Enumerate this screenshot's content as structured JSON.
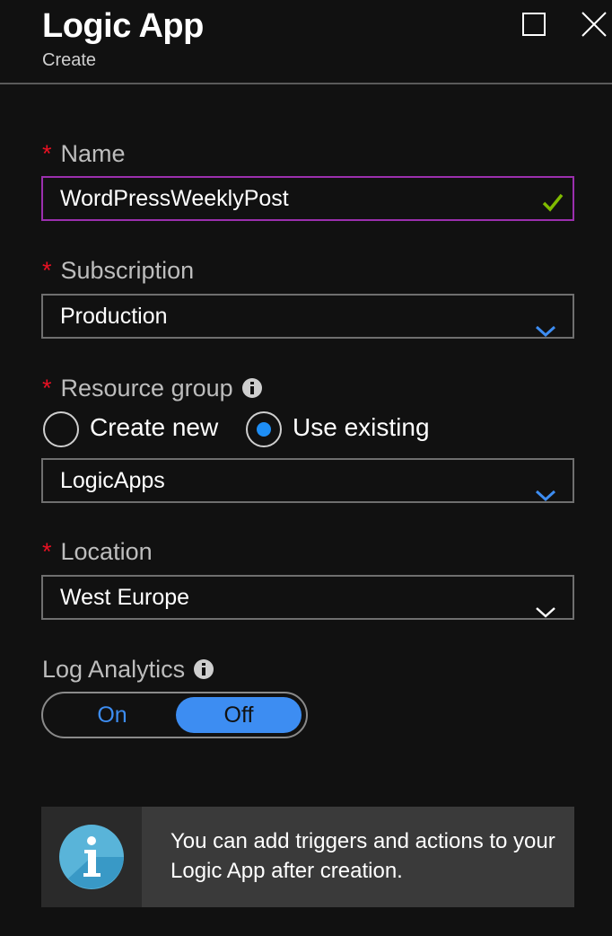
{
  "window": {
    "title": "Logic App",
    "subtitle": "Create"
  },
  "colors": {
    "background": "#111111",
    "required_asterisk": "#e81123",
    "focus_border": "#9b2fae",
    "valid_check": "#7fba00",
    "accent_blue": "#3d8df2",
    "info_panel": "#3a3a3a"
  },
  "form": {
    "name": {
      "required_mark": "*",
      "label": "Name",
      "value": "WordPressWeeklyPost",
      "state_icon": "checkmark-icon"
    },
    "subscription": {
      "required_mark": "*",
      "label": "Subscription",
      "value": "Production",
      "icon": "chevron-down-icon"
    },
    "resource_group": {
      "required_mark": "*",
      "label": "Resource group",
      "info_icon": "info-icon",
      "options": [
        {
          "label": "Create new",
          "checked": false
        },
        {
          "label": "Use existing",
          "checked": true
        }
      ],
      "value": "LogicApps",
      "icon": "chevron-down-icon"
    },
    "location": {
      "required_mark": "*",
      "label": "Location",
      "value": "West Europe",
      "icon": "chevron-down-icon"
    },
    "log_analytics": {
      "label": "Log Analytics",
      "info_icon": "info-icon",
      "on_label": "On",
      "off_label": "Off",
      "selected": "Off"
    }
  },
  "info_message": {
    "icon": "info-icon",
    "text": "You can add triggers and actions to your Logic App after creation."
  }
}
